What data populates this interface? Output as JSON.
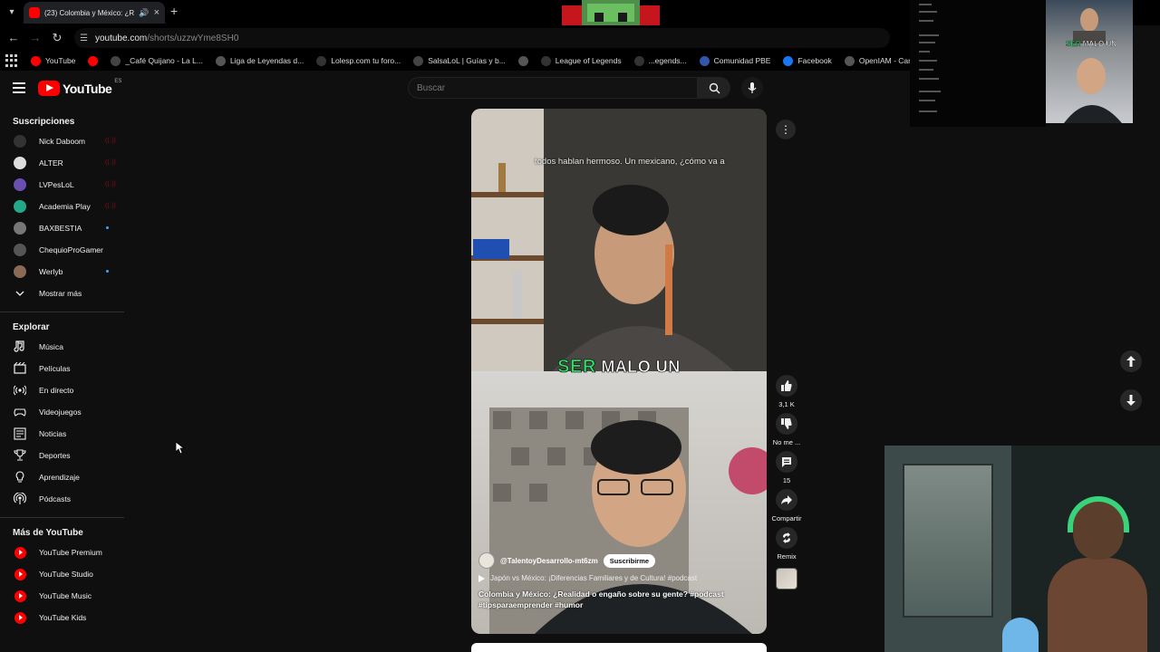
{
  "browser": {
    "tab_title": "(23) Colombia y México: ¿Re",
    "url_host": "youtube.com",
    "url_path": "/shorts/uzzwYme8SH0"
  },
  "bookmarks": [
    {
      "label": "YouTube",
      "color": "#ff0000"
    },
    {
      "label": "",
      "color": "#ff0000"
    },
    {
      "label": "_Café Quijano - La L...",
      "color": "#444444"
    },
    {
      "label": "Liga de Leyendas d...",
      "color": "#555555"
    },
    {
      "label": "Lolesp.com tu foro...",
      "color": "#333333"
    },
    {
      "label": "SalsaLoL | Guías y b...",
      "color": "#444444"
    },
    {
      "label": "",
      "color": "#555555"
    },
    {
      "label": "League of Legends",
      "color": "#333333"
    },
    {
      "label": "...egends...",
      "color": "#333333"
    },
    {
      "label": "Comunidad PBE",
      "color": "#3355aa"
    },
    {
      "label": "Facebook",
      "color": "#1877f2"
    },
    {
      "label": "OpenIAM - Cambiar...",
      "color": "#555555"
    }
  ],
  "yt": {
    "logo": "YouTube",
    "country": "ES",
    "search_placeholder": "Buscar"
  },
  "sidebar": {
    "subs_title": "Suscripciones",
    "subs": [
      {
        "label": "Nick Daboom",
        "badge": "live",
        "avatar": "#333333"
      },
      {
        "label": "ALTER",
        "badge": "live",
        "avatar": "#dddddd"
      },
      {
        "label": "LVPesLoL",
        "badge": "live",
        "avatar": "#6a4fb3"
      },
      {
        "label": "Academia Play",
        "badge": "live",
        "avatar": "#22aa88"
      },
      {
        "label": "BAXBESTIA",
        "badge": "dot",
        "avatar": "#777777"
      },
      {
        "label": "ChequioProGamer",
        "badge": "",
        "avatar": "#555555"
      },
      {
        "label": "Werlyb",
        "badge": "dot",
        "avatar": "#8a6a55"
      }
    ],
    "show_more": "Mostrar más",
    "explore_title": "Explorar",
    "explore": [
      {
        "label": "Música",
        "icon": "music-icon"
      },
      {
        "label": "Películas",
        "icon": "film-icon"
      },
      {
        "label": "En directo",
        "icon": "live-icon"
      },
      {
        "label": "Videojuegos",
        "icon": "gaming-icon"
      },
      {
        "label": "Noticias",
        "icon": "news-icon"
      },
      {
        "label": "Deportes",
        "icon": "trophy-icon"
      },
      {
        "label": "Aprendizaje",
        "icon": "bulb-icon"
      },
      {
        "label": "Pódcasts",
        "icon": "podcast-icon"
      }
    ],
    "more_title": "Más de YouTube",
    "more": [
      {
        "label": "YouTube Premium"
      },
      {
        "label": "YouTube Studio"
      },
      {
        "label": "YouTube Music"
      },
      {
        "label": "YouTube Kids"
      }
    ]
  },
  "short": {
    "caption": "todos hablan hermoso. Un mexicano, ¿cómo va a",
    "subtitle_highlight": "SER",
    "subtitle_rest": "MALO UN",
    "channel": "@TalentoyDesarrollo-mt6zm",
    "subscribe": "Suscribirme",
    "related": "Japón vs México: ¡Diferencias Familiares y de Cultura! #podcast",
    "title_line1": "Colombia y México: ¿Realidad o engaño sobre su gente? #podcast",
    "title_line2": "#tipsparaemprender #humor"
  },
  "actions": {
    "likes": "3,1 K",
    "dislike": "No me ...",
    "comments": "15",
    "share": "Compartir",
    "remix": "Remix"
  },
  "overlay": {
    "banner_hl": "SER",
    "banner_rest": "MALO UN"
  }
}
